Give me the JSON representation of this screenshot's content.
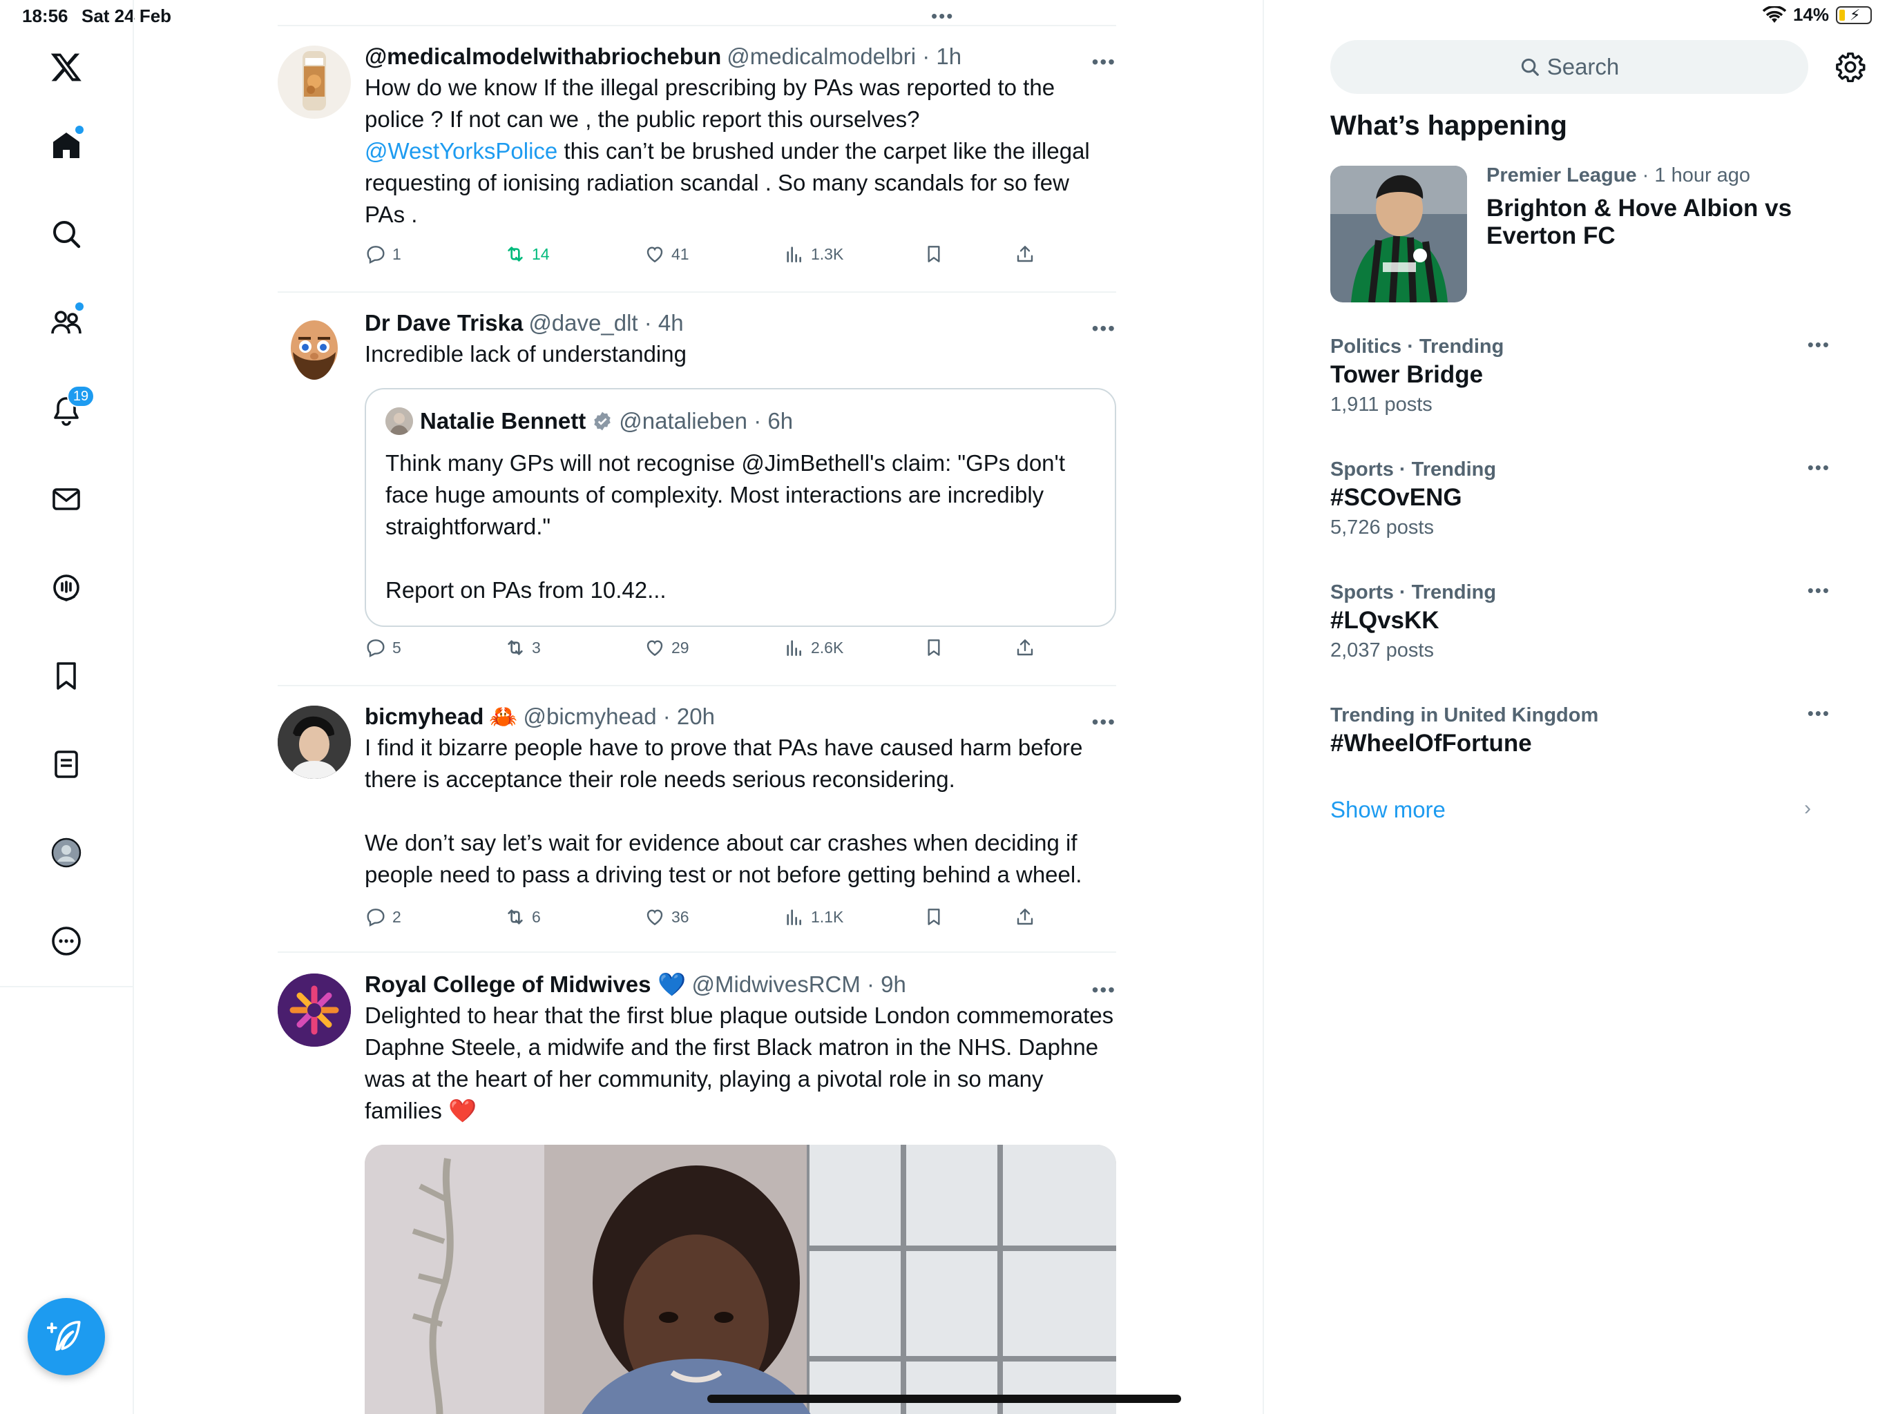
{
  "status_bar": {
    "time": "18:56",
    "date": "Sat 24 Feb",
    "battery": "14%"
  },
  "nav": {
    "notifications_badge": "19"
  },
  "top_cutoff_more": "•••",
  "tweets": [
    {
      "name": "@medicalmodelwithabriochebun",
      "meta": "@medicalmodelbri · 1h",
      "text_part1": "How do we know If the illegal prescribing by PAs was reported to the police ? If not can we , the public report this ourselves? ",
      "mention": "@WestYorksPolice",
      "text_part2": " this can’t be brushed under the carpet like the illegal requesting of ionising radiation scandal . So many scandals for so few PAs .",
      "replies": "1",
      "reposts": "14",
      "likes": "41",
      "views": "1.3K"
    },
    {
      "name": "Dr Dave Triska",
      "meta": "@dave_dlt · 4h",
      "text": "Incredible lack of understanding",
      "quote": {
        "name": "Natalie Bennett",
        "meta": "@natalieben · 6h",
        "text": "Think many GPs will not recognise @JimBethell's claim: \"GPs don't face huge amounts of complexity. Most interactions are incredibly straightforward.\"\n\nReport on PAs from 10.42..."
      },
      "replies": "5",
      "reposts": "3",
      "likes": "29",
      "views": "2.6K"
    },
    {
      "name": "bicmyhead",
      "name_emoji": "🦀",
      "meta": "@bicmyhead · 20h",
      "text": "I find it bizarre people have to prove that PAs have caused harm before there is acceptance their role needs serious reconsidering.\n\nWe don’t say let’s wait for evidence about car crashes when deciding if people need to pass a driving test or not before getting behind a wheel.",
      "replies": "2",
      "reposts": "6",
      "likes": "36",
      "views": "1.1K"
    },
    {
      "name": "Royal College of Midwives",
      "name_emoji": "💙",
      "meta": "@MidwivesRCM · 9h",
      "text": "Delighted to hear that the first blue plaque outside London commemorates Daphne Steele, a midwife and the first Black matron in the NHS. Daphne was at the heart of her community, playing a pivotal role in so many families ❤️"
    }
  ],
  "sidebar": {
    "search_placeholder": "Search",
    "title": "What’s happening",
    "feature": {
      "category": "Premier League",
      "time": " · 1 hour ago",
      "title": "Brighton & Hove Albion vs Everton FC"
    },
    "trends": [
      {
        "category": "Politics · Trending",
        "name": "Tower Bridge",
        "posts": "1,911 posts"
      },
      {
        "category": "Sports · Trending",
        "name": "#SCOvENG",
        "posts": "5,726 posts"
      },
      {
        "category": "Sports · Trending",
        "name": "#LQvsKK",
        "posts": "2,037 posts"
      },
      {
        "category": "Trending in United Kingdom",
        "name": "#WheelOfFortune",
        "posts": ""
      }
    ],
    "show_more": "Show more"
  },
  "colors": {
    "accent": "#1d9bf0",
    "text": "#0f1419",
    "secondary": "#536471",
    "repost_green": "#00ba7c",
    "border": "#eff3f4"
  }
}
